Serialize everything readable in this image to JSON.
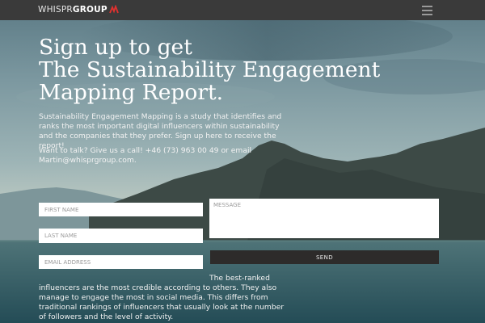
{
  "header": {
    "logo_light": "WHISPR",
    "logo_bold": "GROUP",
    "menu_icon": "hamburger-menu-icon",
    "background_color": "#3a3a3a"
  },
  "hero": {
    "headline_line1": "Sign up to get",
    "headline_line2": "The Sustainability Engagement",
    "headline_line3": "Mapping Report.",
    "intro": "Sustainability Engagement Mapping is a study that identifies and ranks the most important digital influencers within sustainability and the companies that they prefer. Sign up here to receive the report!",
    "contact": "Want to talk? Give us a call! +46 (73) 963 00 49 or email Martin@whisprgroup.com."
  },
  "form": {
    "first_name_placeholder": "FIRST NAME",
    "last_name_placeholder": "LAST NAME",
    "email_placeholder": "EMAIL ADDRESS",
    "message_placeholder": "MESSAGE",
    "send_label": "SEND"
  },
  "footer_text": "The best-ranked influencers are the most credible according to others. They also manage to engage the most in social media. This differs from traditional rankings of influencers that usually look at the number of followers and the level of activity.",
  "colors": {
    "logo_accent": "#e0312f",
    "send_button": "#2d2b2a",
    "sky_top": "#5f7f8a",
    "water": "#2f5a63"
  }
}
